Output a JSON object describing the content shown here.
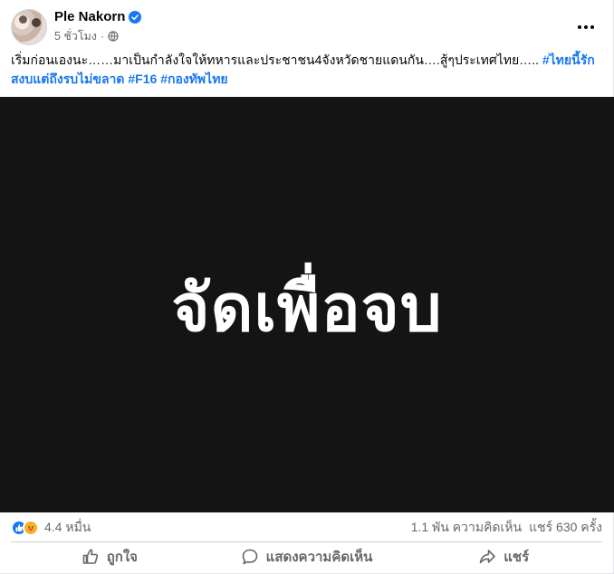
{
  "post": {
    "author": "Ple Nakorn",
    "time": "5 ชั่วโมง",
    "dot": "·",
    "text": "เริ่มก่อนเองนะ……มาเป็นกำลังใจให้ทหารและประชาชน4จังหวัดชายแดนกัน….สู้ๆประเทศไทย…..",
    "hashtags": [
      "#ไทยนี้รักสงบแต่ถึงรบไม่ขลาด",
      "#F16",
      "#กองทัพไทย"
    ],
    "media_text": "จัดเพื่อจบ"
  },
  "stats": {
    "reactions": "4.4 หมื่น",
    "comments": "1.1 พัน ความคิดเห็น",
    "shares": "แชร์ 630 ครั้ง"
  },
  "actions": {
    "like": "ถูกใจ",
    "comment": "แสดงความคิดเห็น",
    "share": "แชร์"
  },
  "icons": {
    "verified": "verified-badge-icon",
    "privacy": "globe-icon",
    "more": "more-options-icon",
    "like": "thumbs-up-icon",
    "comment": "comment-bubble-icon",
    "share": "share-arrow-icon"
  },
  "colors": {
    "accent": "#1877f2",
    "media_bg": "#141414",
    "muted": "#65676b"
  }
}
